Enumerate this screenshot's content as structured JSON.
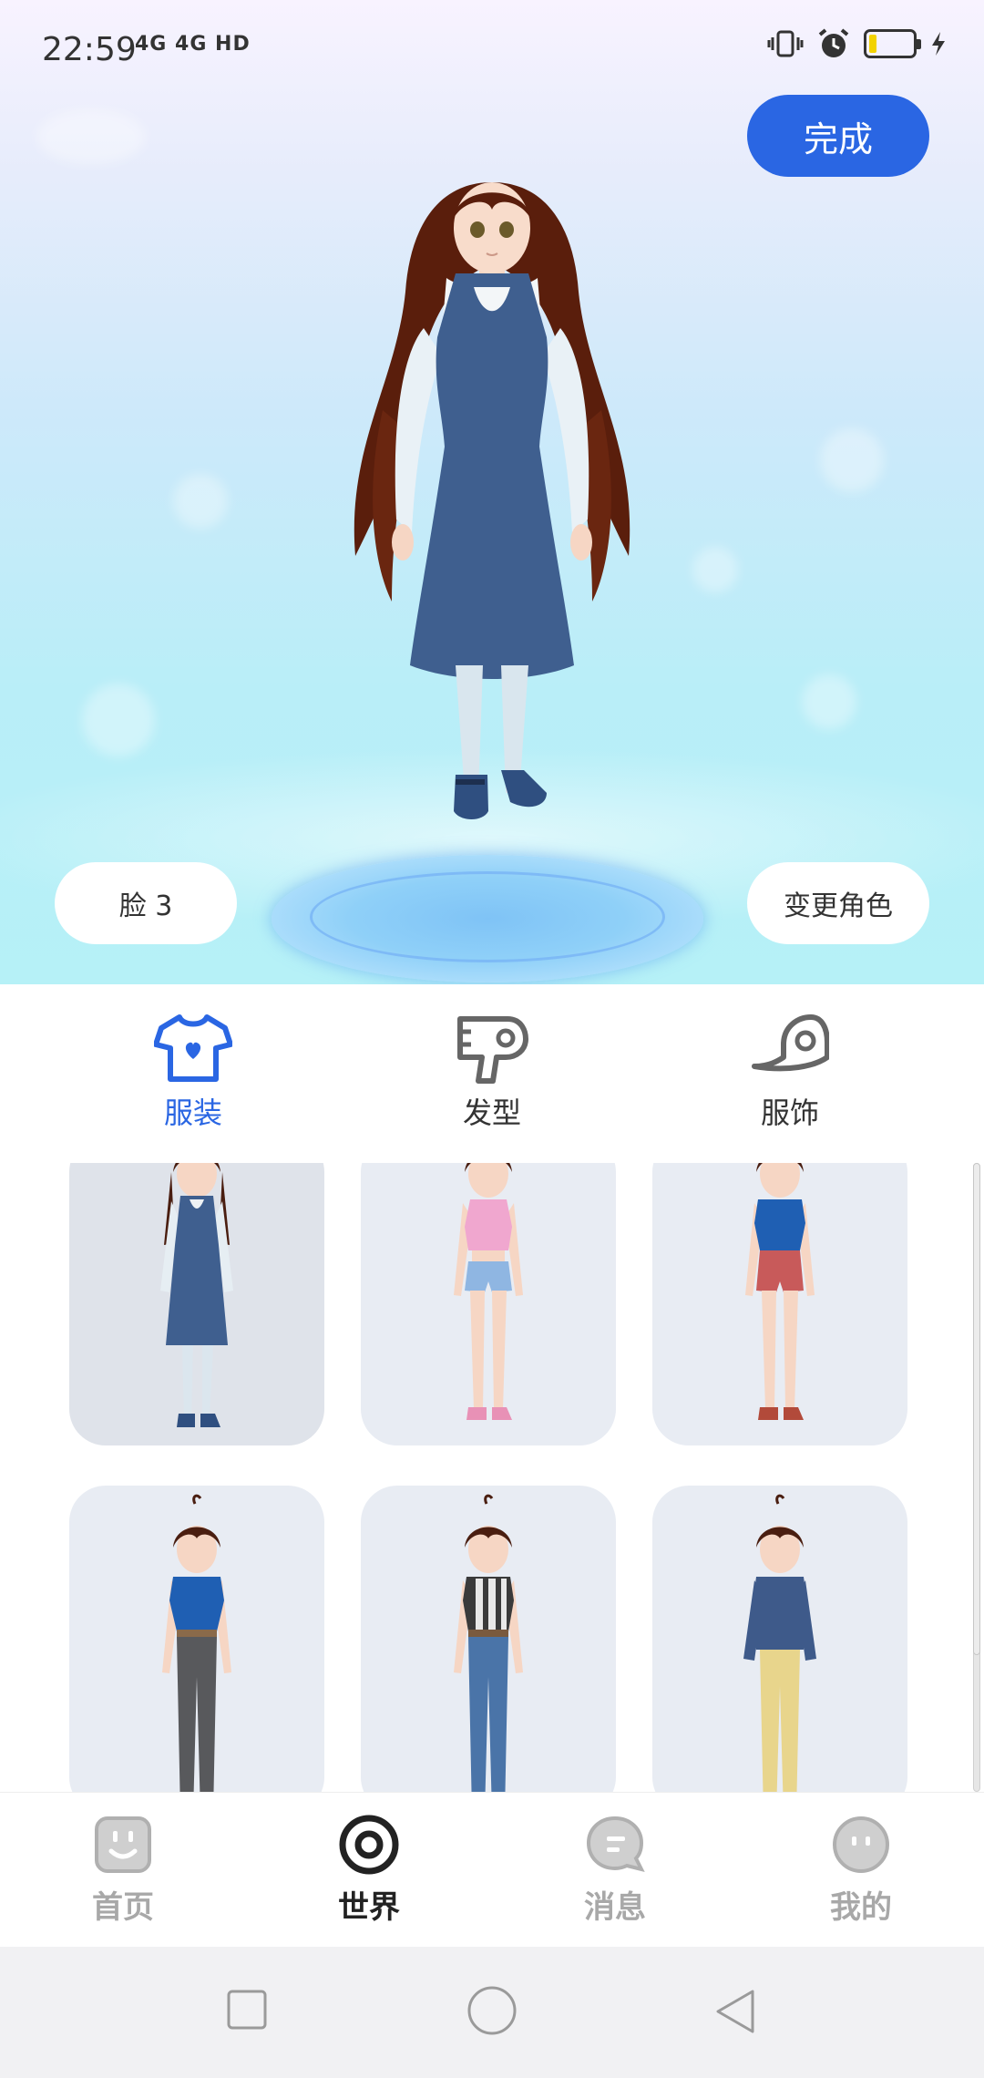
{
  "status_bar": {
    "time": "22:59",
    "network": "4G 4G HD",
    "battery_level": 0.12
  },
  "header": {
    "done_label": "完成"
  },
  "stage": {
    "face_label": "脸 3",
    "change_character_label": "变更角色"
  },
  "category_tabs": [
    {
      "label": "服装",
      "icon": "tshirt-icon",
      "active": true
    },
    {
      "label": "发型",
      "icon": "hair-dryer-icon",
      "active": false
    },
    {
      "label": "服饰",
      "icon": "cap-icon",
      "active": false
    }
  ],
  "outfits": [
    {
      "name": "navy-pinafore-dress",
      "selected": true
    },
    {
      "name": "pink-top-denim-shorts",
      "selected": false
    },
    {
      "name": "blue-top-red-shorts",
      "selected": false
    },
    {
      "name": "blue-top-grey-pants",
      "selected": false
    },
    {
      "name": "striped-top-jeans",
      "selected": false
    },
    {
      "name": "navy-top-yellow-pants",
      "selected": false
    }
  ],
  "bottom_nav": [
    {
      "label": "首页",
      "icon": "home-face-icon",
      "active": false
    },
    {
      "label": "世界",
      "icon": "world-target-icon",
      "active": true
    },
    {
      "label": "消息",
      "icon": "message-bubble-icon",
      "active": false
    },
    {
      "label": "我的",
      "icon": "profile-face-icon",
      "active": false
    }
  ],
  "colors": {
    "accent": "#2a66e3",
    "inactive": "#a8a8a8"
  }
}
